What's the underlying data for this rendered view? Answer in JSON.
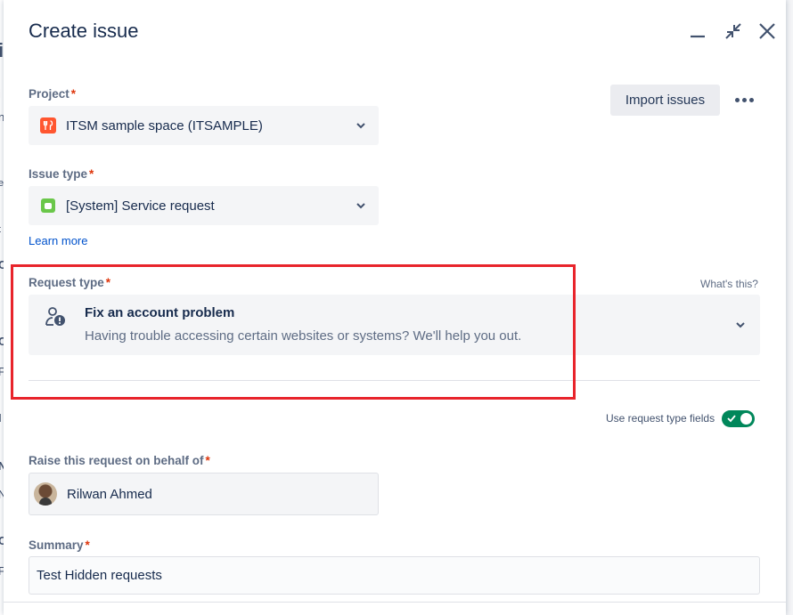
{
  "background": {
    "glyphs": [
      "i",
      "i",
      "n",
      "e",
      "t",
      "C",
      "C",
      "F",
      "I",
      "N",
      "N",
      "C",
      "F"
    ]
  },
  "dialog": {
    "title": "Create issue",
    "minimize_icon": "minimize-icon",
    "collapse_icon": "collapse-icon",
    "close_icon": "close-icon",
    "import_button": "Import issues",
    "more_icon": "more-icon"
  },
  "project": {
    "label": "Project",
    "required_mark": "*",
    "value": "ITSM sample space (ITSAMPLE)",
    "icon": "project-icon",
    "icon_color": "#ff5630"
  },
  "issue_type": {
    "label": "Issue type",
    "required_mark": "*",
    "value": "[System] Service request",
    "icon": "service-request-icon",
    "icon_color": "#6ac74a"
  },
  "learn_more": "Learn more",
  "request_type": {
    "label": "Request type",
    "required_mark": "*",
    "whats_this": "What's this?",
    "title": "Fix an account problem",
    "description": "Having trouble accessing certain websites or systems? We'll help you out.",
    "icon": "account-problem-icon"
  },
  "request_type_fields": {
    "label": "Use request type fields",
    "enabled": true,
    "toggle_color": "#00875a"
  },
  "on_behalf": {
    "label": "Raise this request on behalf of",
    "required_mark": "*",
    "value": "Rilwan Ahmed",
    "avatar": "user-avatar"
  },
  "summary": {
    "label": "Summary",
    "required_mark": "*",
    "value": "Test Hidden requests"
  },
  "highlight_color": "#e8242b"
}
